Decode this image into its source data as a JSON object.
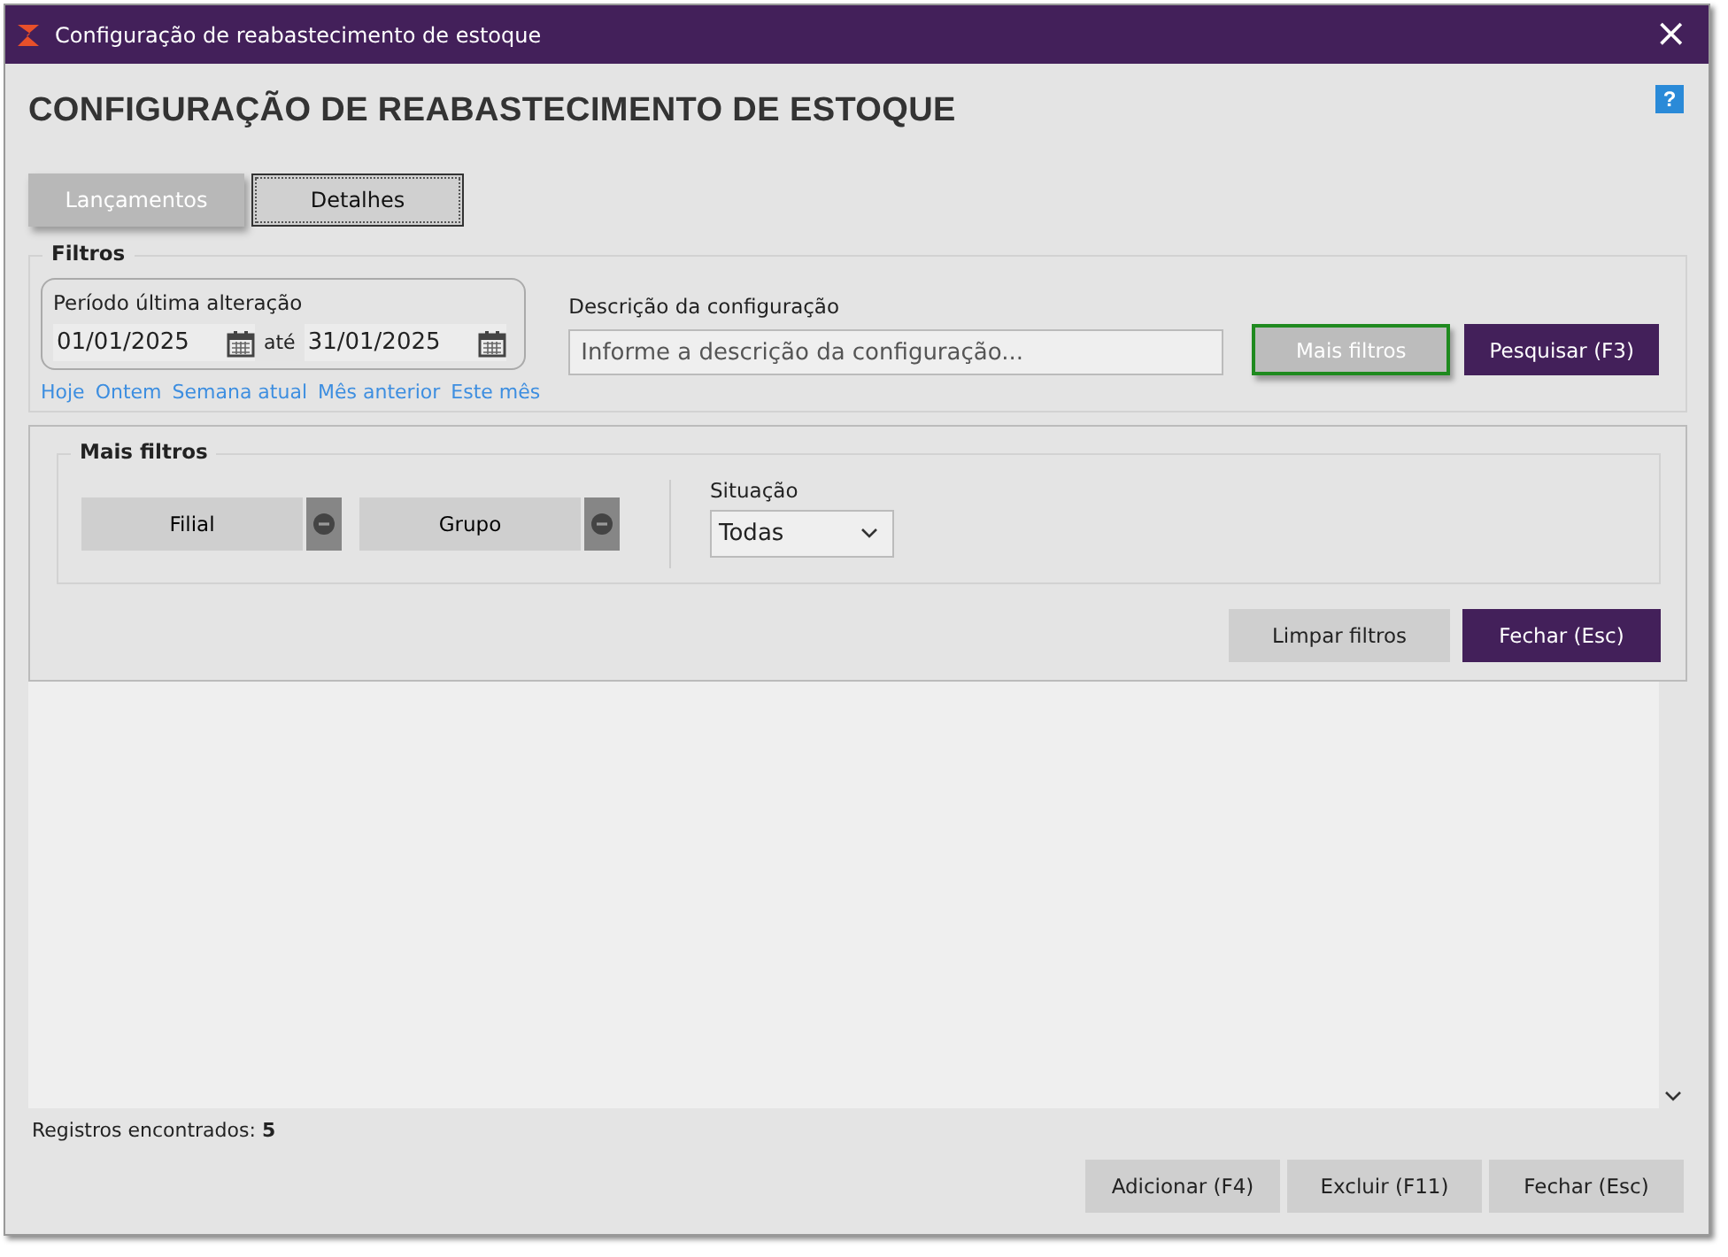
{
  "window": {
    "title": "Configuração de reabastecimento de estoque",
    "close": "×"
  },
  "heading": "CONFIGURAÇÃO DE REABASTECIMENTO DE ESTOQUE",
  "help": "?",
  "tabs": [
    {
      "label": "Lançamentos",
      "selected": true
    },
    {
      "label": "Detalhes",
      "selected": false
    }
  ],
  "filters": {
    "legend": "Filtros",
    "period": {
      "label": "Período última alteração",
      "from": "01/01/2025",
      "separator": "até",
      "to": "31/01/2025"
    },
    "quick_links": [
      "Hoje",
      "Ontem",
      "Semana atual",
      "Mês anterior",
      "Este mês"
    ],
    "description": {
      "label": "Descrição da configuração",
      "placeholder": "Informe a descrição da configuração..."
    },
    "buttons": [
      {
        "label": "Mais filtros",
        "kind": "toggle",
        "selected": true
      },
      {
        "label": "Pesquisar (F3)",
        "kind": "primary"
      }
    ]
  },
  "more_filters": {
    "legend": "Mais filtros",
    "pickers": [
      "Filial",
      "Grupo"
    ],
    "status": {
      "label": "Situação",
      "value": "Todas"
    },
    "buttons": [
      {
        "label": "Limpar filtros",
        "kind": "secondary"
      },
      {
        "label": "Fechar (Esc)",
        "kind": "primary"
      }
    ]
  },
  "status_bar": {
    "text": "Registros encontrados: **5**"
  },
  "footer_buttons": [
    "Adicionar (F4)",
    "Excluir (F11)",
    "Fechar (Esc)"
  ]
}
